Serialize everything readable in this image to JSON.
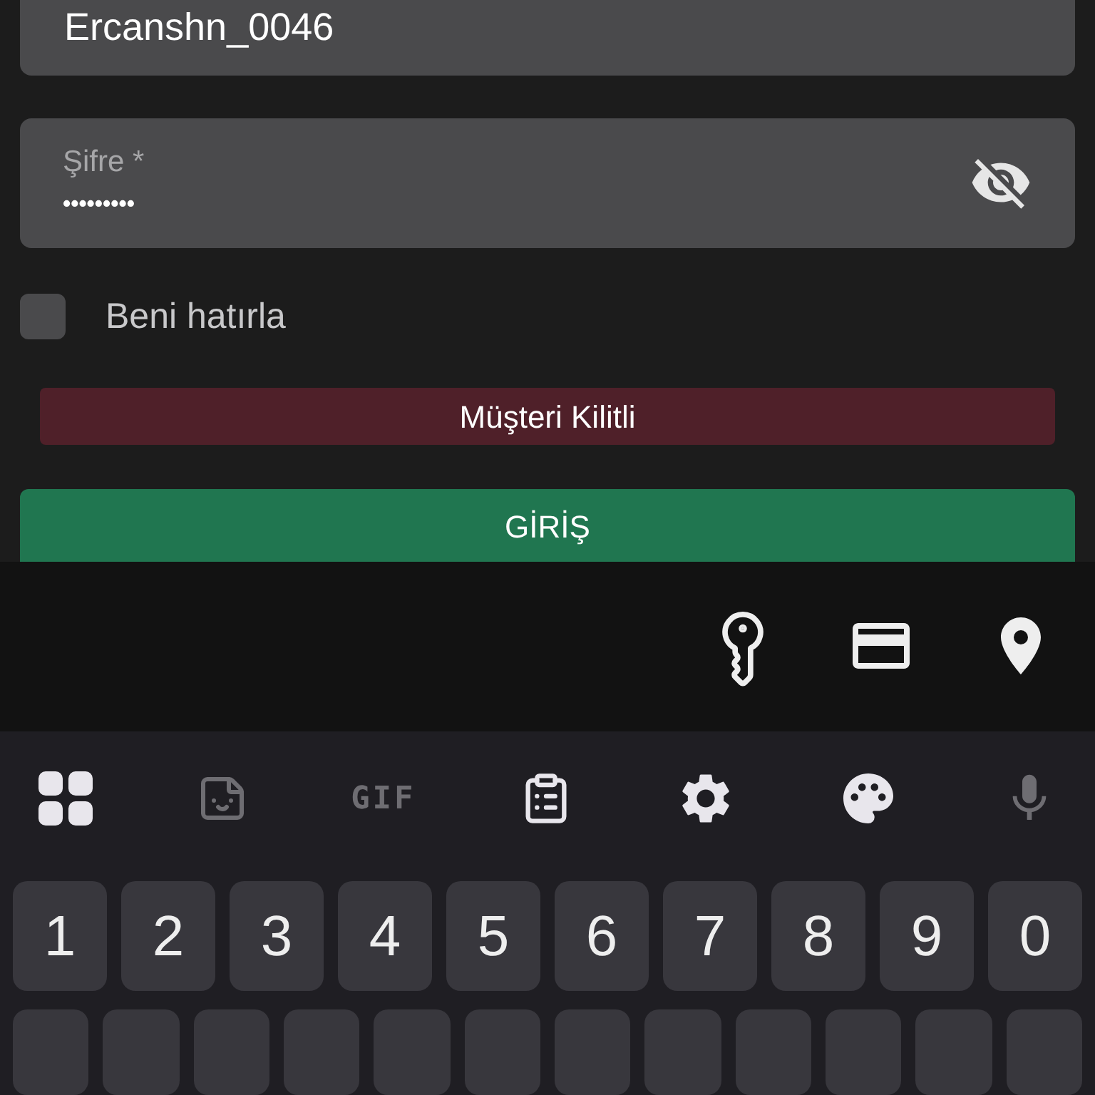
{
  "username_field": {
    "value": "Ercanshn_0046"
  },
  "password_field": {
    "label": "Şifre *",
    "value": "•••••••••",
    "visible": false
  },
  "remember_me": {
    "label": "Beni hatırla",
    "checked": false
  },
  "alert": {
    "text": "Müşteri Kilitli"
  },
  "login_button": {
    "label": "GİRİŞ"
  },
  "autofill_bar": [
    {
      "kind": "key"
    },
    {
      "kind": "card"
    },
    {
      "kind": "location"
    }
  ],
  "keyboard_toolbar": [
    {
      "kind": "grid",
      "disabled": false
    },
    {
      "kind": "sticker",
      "disabled": true
    },
    {
      "kind": "gif",
      "label": "GIF",
      "disabled": true
    },
    {
      "kind": "clipboard",
      "disabled": false
    },
    {
      "kind": "settings",
      "disabled": false
    },
    {
      "kind": "palette",
      "disabled": false
    },
    {
      "kind": "mic",
      "disabled": true
    }
  ],
  "number_keys": [
    "1",
    "2",
    "3",
    "4",
    "5",
    "6",
    "7",
    "8",
    "9",
    "0"
  ]
}
